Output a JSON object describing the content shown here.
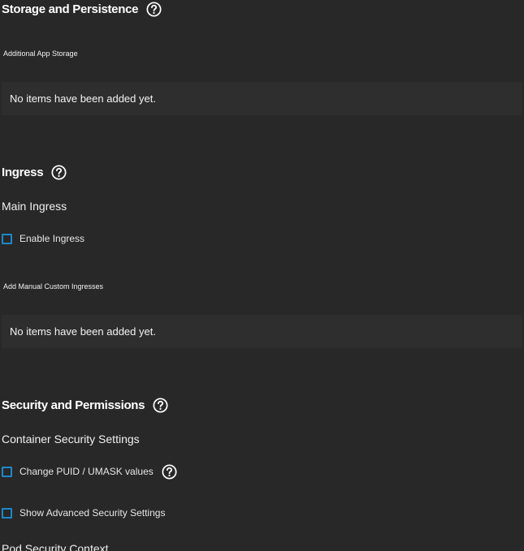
{
  "storage": {
    "title": "Storage and Persistence",
    "help_icon": "help-circle-icon",
    "additional_label": "Additional App Storage",
    "empty_text": "No items have been added yet."
  },
  "ingress": {
    "title": "Ingress",
    "help_icon": "help-circle-icon",
    "main_label": "Main Ingress",
    "enable_label": "Enable Ingress",
    "custom_label": "Add Manual Custom Ingresses",
    "empty_text": "No items have been added yet."
  },
  "security": {
    "title": "Security and Permissions",
    "help_icon": "help-circle-icon",
    "container_label": "Container Security Settings",
    "puid_label": "Change PUID / UMASK values",
    "advanced_label": "Show Advanced Security Settings",
    "pod_context_label": "Pod Security Context"
  },
  "colors": {
    "background": "#282828",
    "panel": "#2e2e2e",
    "checkbox_border": "#1e88c7",
    "text": "#ffffff"
  }
}
